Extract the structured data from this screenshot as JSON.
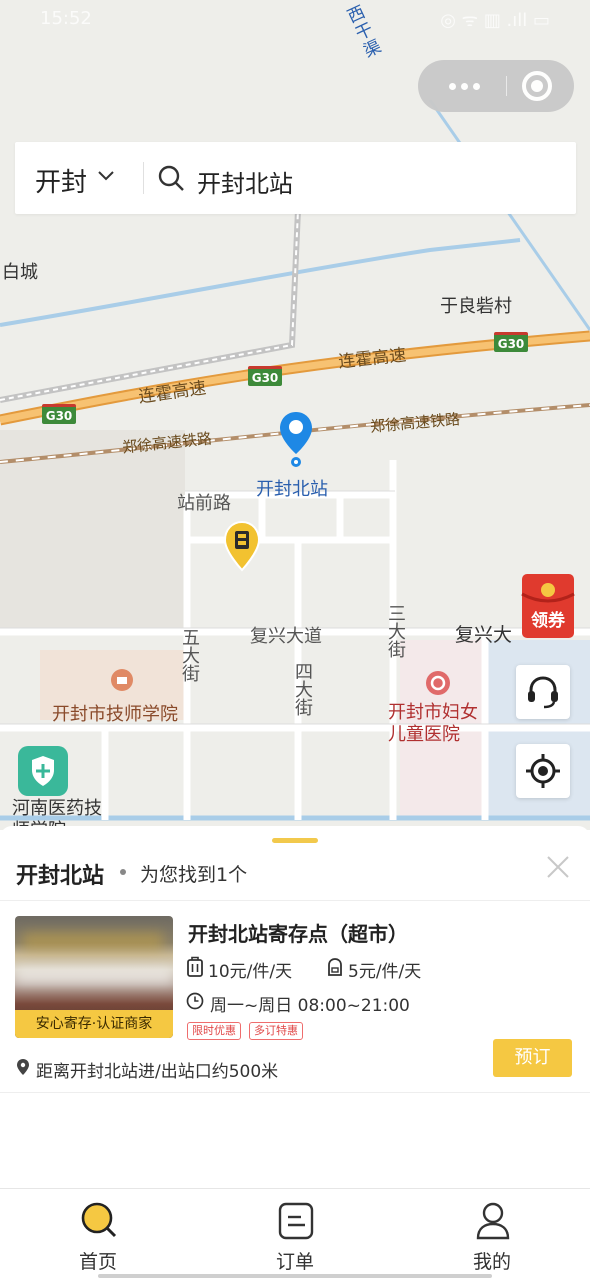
{
  "status_bar": {
    "time": "15:52",
    "icons_text": "◎ ᯤ ▥ .ıll ▭"
  },
  "search": {
    "city": "开封",
    "query": "开封北站"
  },
  "map": {
    "labels": {
      "canal": "西干渠",
      "baicheng": "白城",
      "yuliang": "于良砦村",
      "expressway_1": "连霍高速",
      "expressway_2": "连霍高速",
      "railway_1": "郑徐高速铁路",
      "railway_2": "郑徐高速铁路",
      "station": "开封北站",
      "zhanqian": "站前路",
      "fuxing_1": "复兴大道",
      "fuxing_2": "复兴大",
      "wu": "五大街",
      "si": "四大街",
      "san": "三大街",
      "jishi": "开封市技师学院",
      "fuyou": "开封市妇女儿童医院",
      "henan": "河南医药技师学院"
    },
    "shields": [
      "G30",
      "G30",
      "G30"
    ],
    "coupon_label": "领券"
  },
  "result": {
    "title": "开封北站",
    "subtitle": "为您找到1个",
    "store": {
      "name": "开封北站寄存点（超市）",
      "badge": "安心寄存·认证商家",
      "price_luggage": "10元/件/天",
      "price_bag": "5元/件/天",
      "hours": "周一~周日 08:00~21:00",
      "tags": [
        "限时优惠",
        "多订特惠"
      ],
      "book_label": "预订",
      "distance": "距离开封北站进/出站口约500米"
    }
  },
  "tabs": [
    {
      "label": "首页"
    },
    {
      "label": "订单"
    },
    {
      "label": "我的"
    }
  ],
  "colors": {
    "accent": "#f5c842",
    "pin": "#1e88e5",
    "tag_red": "#e04848"
  }
}
